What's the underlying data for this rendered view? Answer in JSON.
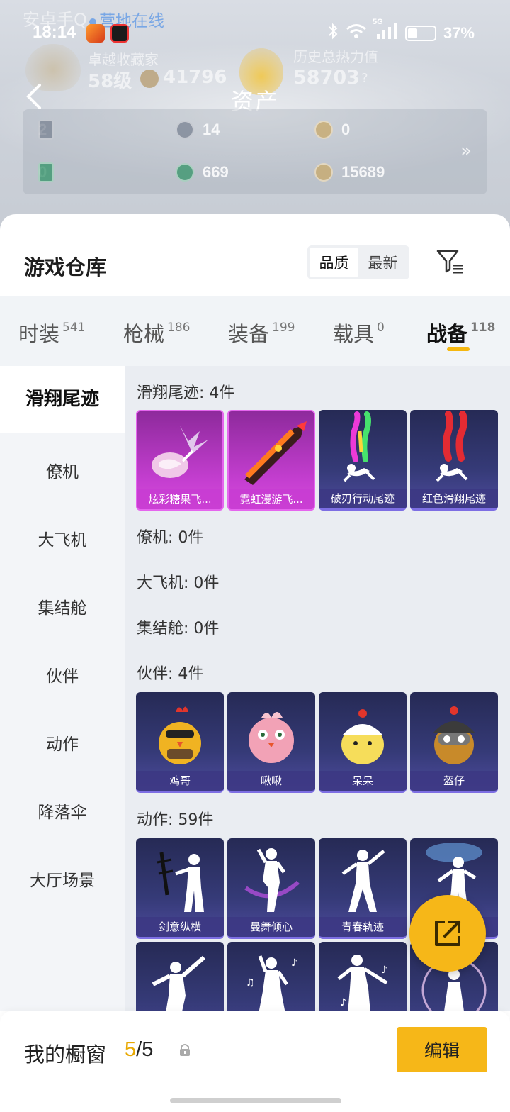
{
  "status": {
    "time": "18:14",
    "network": "5G",
    "battery": "37%",
    "battery_level": 0.37
  },
  "header": {
    "ghost_title": "安卓手Q",
    "online_status": "营地在线",
    "collector_title": "卓越收藏家",
    "collector_level": "58级",
    "collector_points": "41796",
    "heat_label": "历史总热力值",
    "heat_value": "58703",
    "heat_help": "?",
    "page_title": "资产",
    "assets": [
      {
        "icon": "card-icon",
        "value": "2"
      },
      {
        "icon": "silver-coin-icon",
        "value": "14"
      },
      {
        "icon": "gold-badge-icon",
        "value": "0"
      },
      {
        "icon": "green-card-icon",
        "value": "0"
      },
      {
        "icon": "green-coin-icon",
        "value": "669"
      },
      {
        "icon": "bronze-coin-icon",
        "value": "15689"
      }
    ],
    "more": "»"
  },
  "warehouse": {
    "title": "游戏仓库",
    "sort_options": [
      "品质",
      "最新"
    ],
    "sort_selected": "品质"
  },
  "categories": [
    {
      "label": "时装",
      "count": "541"
    },
    {
      "label": "枪械",
      "count": "186"
    },
    {
      "label": "装备",
      "count": "199"
    },
    {
      "label": "载具",
      "count": "0"
    },
    {
      "label": "战备",
      "count": "118"
    }
  ],
  "active_category": "战备",
  "sidebar": {
    "items": [
      "滑翔尾迹",
      "僚机",
      "大飞机",
      "集结舱",
      "伙伴",
      "动作",
      "降落伞",
      "大厅场景"
    ],
    "active": "滑翔尾迹"
  },
  "sections": {
    "glide": {
      "title": "滑翔尾迹: 4件",
      "items": [
        "炫彩糖果飞...",
        "霓虹漫游飞...",
        "破刃行动尾迹",
        "红色滑翔尾迹"
      ]
    },
    "wingman": {
      "title": "僚机: 0件"
    },
    "plane": {
      "title": "大飞机: 0件"
    },
    "capsule": {
      "title": "集结舱: 0件"
    },
    "partner": {
      "title": "伙伴: 4件",
      "items": [
        "鸡哥",
        "啾啾",
        "呆呆",
        "盔仔"
      ]
    },
    "emote": {
      "title": "动作: 59件",
      "items": [
        "剑意纵横",
        "曼舞倾心",
        "青春轨迹",
        "",
        "",
        "",
        "",
        ""
      ]
    }
  },
  "showcase": {
    "title": "我的橱窗",
    "used": "5",
    "separator": "/",
    "total": "5",
    "edit_label": "编辑"
  },
  "colors": {
    "accent": "#f6b718",
    "quality_purple": "#c43ed0",
    "quality_blue": "#353a77"
  }
}
